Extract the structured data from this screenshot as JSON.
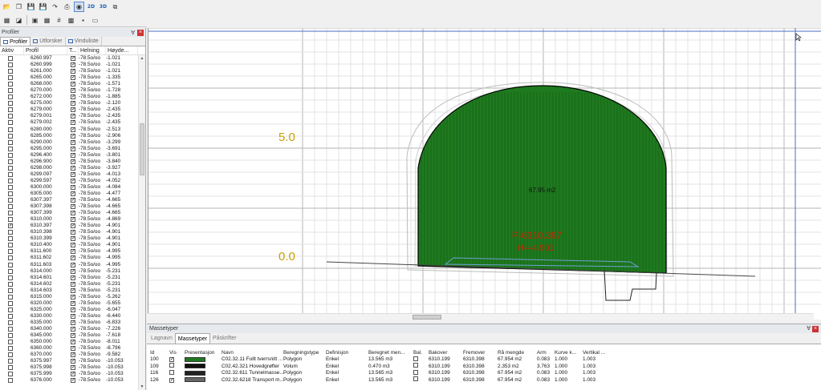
{
  "toolbar": {
    "row1": [
      "folder-open-icon",
      "copy-icon",
      "save-icon",
      "save-as-icon",
      "export-icon",
      "print-icon",
      "select-icon",
      "2d-icon",
      "3d-icon",
      "layers-icon"
    ],
    "label_2d": "2D",
    "label_3d": "3D"
  },
  "left_panel": {
    "title": "Profiler",
    "tabs": [
      "Profiler",
      "Utforsker",
      "Vinduliste"
    ],
    "columns": [
      "Aktiv",
      "Profil",
      "T...",
      "Helning",
      "Høyde..."
    ],
    "rows": [
      {
        "aktiv": false,
        "profil": "6260.997",
        "t": true,
        "helning": "-78.5o/oo",
        "hoyde": "-1.021"
      },
      {
        "aktiv": false,
        "profil": "6260.999",
        "t": true,
        "helning": "-78.5o/oo",
        "hoyde": "-1.021"
      },
      {
        "aktiv": false,
        "profil": "6261.000",
        "t": true,
        "helning": "-78.5o/oo",
        "hoyde": "-1.021"
      },
      {
        "aktiv": false,
        "profil": "6265.000",
        "t": true,
        "helning": "-78.5o/oo",
        "hoyde": "-1.335"
      },
      {
        "aktiv": false,
        "profil": "6268.000",
        "t": true,
        "helning": "-78.5o/oo",
        "hoyde": "-1.571"
      },
      {
        "aktiv": false,
        "profil": "6270.000",
        "t": true,
        "helning": "-78.5o/oo",
        "hoyde": "-1.728"
      },
      {
        "aktiv": false,
        "profil": "6272.000",
        "t": true,
        "helning": "-78.5o/oo",
        "hoyde": "-1.885"
      },
      {
        "aktiv": false,
        "profil": "6275.000",
        "t": true,
        "helning": "-78.5o/oo",
        "hoyde": "-2.120"
      },
      {
        "aktiv": false,
        "profil": "6279.000",
        "t": true,
        "helning": "-78.5o/oo",
        "hoyde": "-2.435"
      },
      {
        "aktiv": false,
        "profil": "6279.001",
        "t": true,
        "helning": "-78.5o/oo",
        "hoyde": "-2.435"
      },
      {
        "aktiv": false,
        "profil": "6279.002",
        "t": true,
        "helning": "-78.5o/oo",
        "hoyde": "-2.435"
      },
      {
        "aktiv": false,
        "profil": "6280.000",
        "t": true,
        "helning": "-78.5o/oo",
        "hoyde": "-2.513"
      },
      {
        "aktiv": false,
        "profil": "6285.000",
        "t": true,
        "helning": "-78.5o/oo",
        "hoyde": "-2.906"
      },
      {
        "aktiv": false,
        "profil": "6290.000",
        "t": true,
        "helning": "-78.5o/oo",
        "hoyde": "-3.299"
      },
      {
        "aktiv": false,
        "profil": "6295.000",
        "t": true,
        "helning": "-78.5o/oo",
        "hoyde": "-3.691"
      },
      {
        "aktiv": false,
        "profil": "6296.400",
        "t": true,
        "helning": "-78.5o/oo",
        "hoyde": "-3.801"
      },
      {
        "aktiv": false,
        "profil": "6296.900",
        "t": true,
        "helning": "-78.5o/oo",
        "hoyde": "-3.840"
      },
      {
        "aktiv": false,
        "profil": "6298.000",
        "t": true,
        "helning": "-78.5o/oo",
        "hoyde": "-3.927"
      },
      {
        "aktiv": false,
        "profil": "6299.097",
        "t": true,
        "helning": "-78.5o/oo",
        "hoyde": "-4.013"
      },
      {
        "aktiv": false,
        "profil": "6299.597",
        "t": true,
        "helning": "-78.5o/oo",
        "hoyde": "-4.052"
      },
      {
        "aktiv": false,
        "profil": "6300.000",
        "t": true,
        "helning": "-78.5o/oo",
        "hoyde": "-4.084"
      },
      {
        "aktiv": false,
        "profil": "6305.000",
        "t": true,
        "helning": "-78.5o/oo",
        "hoyde": "-4.477"
      },
      {
        "aktiv": false,
        "profil": "6307.397",
        "t": true,
        "helning": "-78.5o/oo",
        "hoyde": "-4.665"
      },
      {
        "aktiv": false,
        "profil": "6307.398",
        "t": true,
        "helning": "-78.5o/oo",
        "hoyde": "-4.665"
      },
      {
        "aktiv": false,
        "profil": "6307.399",
        "t": true,
        "helning": "-78.5o/oo",
        "hoyde": "-4.665"
      },
      {
        "aktiv": false,
        "profil": "6310.000",
        "t": true,
        "helning": "-78.5o/oo",
        "hoyde": "-4.869"
      },
      {
        "aktiv": true,
        "profil": "6310.397",
        "t": true,
        "helning": "-78.5o/oo",
        "hoyde": "-4.901"
      },
      {
        "aktiv": false,
        "profil": "6310.398",
        "t": true,
        "helning": "-78.5o/oo",
        "hoyde": "-4.901"
      },
      {
        "aktiv": false,
        "profil": "6310.399",
        "t": true,
        "helning": "-78.5o/oo",
        "hoyde": "-4.901"
      },
      {
        "aktiv": false,
        "profil": "6310.400",
        "t": true,
        "helning": "-78.5o/oo",
        "hoyde": "-4.901"
      },
      {
        "aktiv": false,
        "profil": "6311.600",
        "t": true,
        "helning": "-78.5o/oo",
        "hoyde": "-4.995"
      },
      {
        "aktiv": false,
        "profil": "6311.602",
        "t": true,
        "helning": "-78.5o/oo",
        "hoyde": "-4.995"
      },
      {
        "aktiv": false,
        "profil": "6311.603",
        "t": true,
        "helning": "-78.5o/oo",
        "hoyde": "-4.995"
      },
      {
        "aktiv": false,
        "profil": "6314.000",
        "t": true,
        "helning": "-78.5o/oo",
        "hoyde": "-5.231"
      },
      {
        "aktiv": false,
        "profil": "6314.601",
        "t": true,
        "helning": "-78.5o/oo",
        "hoyde": "-5.231"
      },
      {
        "aktiv": false,
        "profil": "6314.602",
        "t": true,
        "helning": "-78.5o/oo",
        "hoyde": "-5.231"
      },
      {
        "aktiv": false,
        "profil": "6314.603",
        "t": true,
        "helning": "-78.5o/oo",
        "hoyde": "-5.231"
      },
      {
        "aktiv": false,
        "profil": "6315.000",
        "t": true,
        "helning": "-78.5o/oo",
        "hoyde": "-5.262"
      },
      {
        "aktiv": false,
        "profil": "6320.000",
        "t": true,
        "helning": "-78.5o/oo",
        "hoyde": "-5.655"
      },
      {
        "aktiv": false,
        "profil": "6325.000",
        "t": true,
        "helning": "-78.5o/oo",
        "hoyde": "-6.047"
      },
      {
        "aktiv": false,
        "profil": "6330.000",
        "t": true,
        "helning": "-78.5o/oo",
        "hoyde": "-6.440"
      },
      {
        "aktiv": false,
        "profil": "6335.000",
        "t": true,
        "helning": "-78.5o/oo",
        "hoyde": "-6.833"
      },
      {
        "aktiv": false,
        "profil": "6340.000",
        "t": true,
        "helning": "-78.5o/oo",
        "hoyde": "-7.226"
      },
      {
        "aktiv": false,
        "profil": "6345.000",
        "t": true,
        "helning": "-78.5o/oo",
        "hoyde": "-7.618"
      },
      {
        "aktiv": false,
        "profil": "6350.000",
        "t": true,
        "helning": "-78.5o/oo",
        "hoyde": "-8.011"
      },
      {
        "aktiv": false,
        "profil": "6360.000",
        "t": true,
        "helning": "-78.5o/oo",
        "hoyde": "-8.796"
      },
      {
        "aktiv": false,
        "profil": "6370.000",
        "t": true,
        "helning": "-78.5o/oo",
        "hoyde": "-9.582"
      },
      {
        "aktiv": false,
        "profil": "6375.997",
        "t": true,
        "helning": "-78.5o/oo",
        "hoyde": "-10.053"
      },
      {
        "aktiv": false,
        "profil": "6375.998",
        "t": true,
        "helning": "-78.5o/oo",
        "hoyde": "-10.053"
      },
      {
        "aktiv": false,
        "profil": "6375.999",
        "t": true,
        "helning": "-78.5o/oo",
        "hoyde": "-10.053"
      },
      {
        "aktiv": false,
        "profil": "6376.000",
        "t": true,
        "helning": "-78.5o/oo",
        "hoyde": "-10.053"
      }
    ]
  },
  "canvas": {
    "y_label_top": "5.0",
    "y_label_bottom": "0.0",
    "area_label": "67.95 m2",
    "profile_label": "P-6310.397",
    "height_label": "H=-4.901",
    "colors": {
      "fill": "#1e7a1e",
      "label": "#c8a000",
      "red": "#cc2200"
    }
  },
  "bottom_panel": {
    "title": "Massetyper",
    "tabs": [
      "Lagnavn",
      "Massetyper",
      "Påskrifter"
    ],
    "columns": [
      "Id",
      "Vis",
      "Presentasjon",
      "Navn",
      "Beregningstype",
      "Definisjon",
      "Beregnet men...",
      "Bal.",
      "Bakover",
      "Fremover",
      "Rå mengde",
      "Arm",
      "Kurve k...",
      "Vertikal ..."
    ],
    "rows": [
      {
        "id": "100",
        "vis": true,
        "swatch": "#1e7a1e",
        "navn": "C02.32.11 Fullt tverrsnitt ...",
        "ber": "Polygon",
        "def": "Enkel",
        "beregnet": "13.565 m3",
        "bal": false,
        "bakover": "6310.199",
        "fremover": "6310.398",
        "ra": "67.954 m2",
        "arm": "0.083",
        "kurve": "1.000",
        "vertikal": "1.003"
      },
      {
        "id": "109",
        "vis": false,
        "swatch": "#111111",
        "navn": "C02.42.321 Hovedgrøfter",
        "ber": "Volum",
        "def": "Enkel",
        "beregnet": "0.470 m3",
        "bal": false,
        "bakover": "6310.199",
        "fremover": "6310.398",
        "ra": "2.353 m2",
        "arm": "3.763",
        "kurve": "1.000",
        "vertikal": "1.003"
      },
      {
        "id": "116",
        "vis": false,
        "swatch": "#222222",
        "navn": "C02.32.611 Tunnelmasse...",
        "ber": "Polygon",
        "def": "Enkel",
        "beregnet": "13.565 m3",
        "bal": false,
        "bakover": "6310.199",
        "fremover": "6310.398",
        "ra": "67.954 m2",
        "arm": "0.083",
        "kurve": "1.000",
        "vertikal": "1.003"
      },
      {
        "id": "126",
        "vis": true,
        "swatch": "#666666",
        "navn": "C02.32.6218 Transport m...",
        "ber": "Polygon",
        "def": "Enkel",
        "beregnet": "13.565 m3",
        "bal": false,
        "bakover": "6310.199",
        "fremover": "6310.398",
        "ra": "67.954 m2",
        "arm": "0.083",
        "kurve": "1.000",
        "vertikal": "1.003"
      }
    ]
  }
}
